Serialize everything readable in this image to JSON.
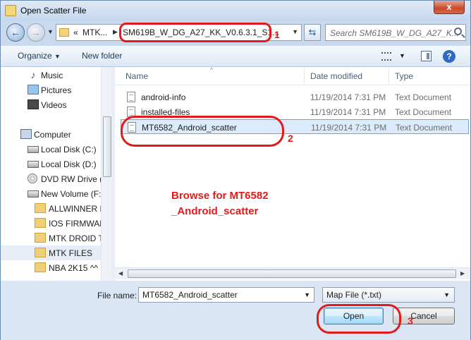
{
  "window": {
    "title": "Open Scatter File",
    "close_glyph": "x"
  },
  "nav": {
    "breadcrumb_overflow": "«",
    "crumbs": [
      "MTK...",
      "SM619B_W_DG_A27_KK_V0.6.3.1_S1..."
    ],
    "search_placeholder": "Search SM619B_W_DG_A27_K..."
  },
  "toolbar": {
    "organize_label": "Organize",
    "new_folder_label": "New folder"
  },
  "sidebar": {
    "items": [
      {
        "label": "Music",
        "icon": "music-icon"
      },
      {
        "label": "Pictures",
        "icon": "pictures-icon"
      },
      {
        "label": "Videos",
        "icon": "videos-icon"
      },
      {
        "label": "Computer",
        "icon": "computer-icon"
      },
      {
        "label": "Local Disk (C:)",
        "icon": "disk-icon"
      },
      {
        "label": "Local Disk (D:)",
        "icon": "disk-icon"
      },
      {
        "label": "DVD RW Drive (",
        "icon": "dvd-icon"
      },
      {
        "label": "New Volume (F:",
        "icon": "disk-icon"
      },
      {
        "label": "ALLWINNER F",
        "icon": "folder-icon"
      },
      {
        "label": "IOS FIRMWAR",
        "icon": "folder-icon"
      },
      {
        "label": "MTK DROID T",
        "icon": "folder-icon"
      },
      {
        "label": "MTK FILES",
        "icon": "folder-icon"
      },
      {
        "label": "NBA 2K15 ^^",
        "icon": "folder-icon"
      }
    ],
    "selected_index": 11
  },
  "columns": {
    "name": "Name",
    "date": "Date modified",
    "type": "Type"
  },
  "files": [
    {
      "name": "android-info",
      "date": "11/19/2014 7:31 PM",
      "type": "Text Document"
    },
    {
      "name": "installed-files",
      "date": "11/19/2014 7:31 PM",
      "type": "Text Document"
    },
    {
      "name": "MT6582_Android_scatter",
      "date": "11/19/2014 7:31 PM",
      "type": "Text Document"
    }
  ],
  "annotations": {
    "note_line1": "Browse for MT6582",
    "note_line2": "_Android_scatter",
    "n1": "1",
    "n2": "2",
    "n3": "3",
    "color": "#e11b1b"
  },
  "footer": {
    "file_name_label": "File name:",
    "file_name_value": "MT6582_Android_scatter",
    "file_type_value": "Map File (*.txt)",
    "open_label": "Open",
    "cancel_label": "Cancel"
  }
}
